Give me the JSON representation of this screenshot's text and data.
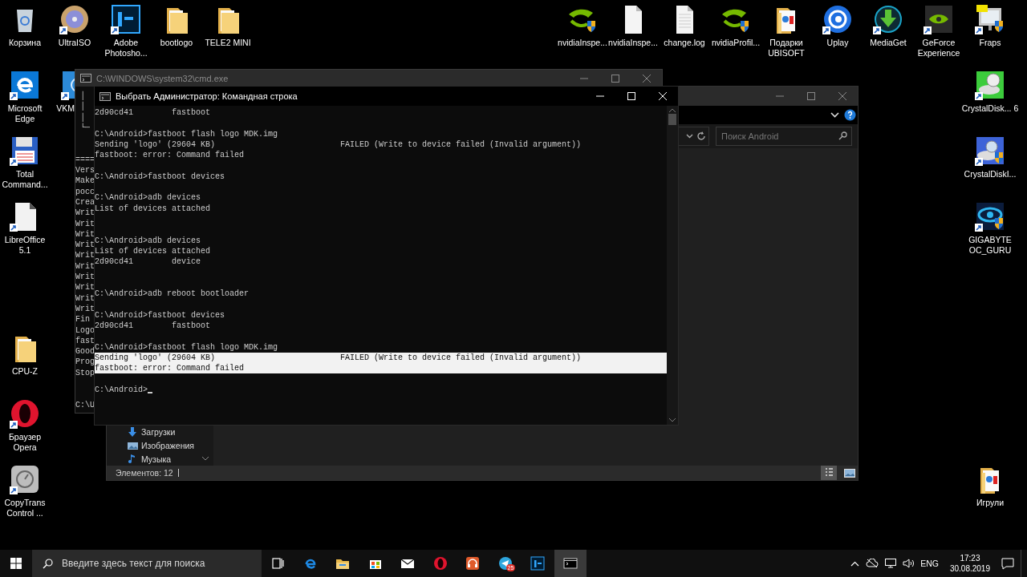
{
  "desktop_icons": [
    {
      "label": "Корзина",
      "kind": "bin",
      "shortcut": false
    },
    {
      "label": "UltraISO",
      "kind": "disc",
      "shortcut": true
    },
    {
      "label": "Adobe Photosho...",
      "kind": "ps",
      "shortcut": true
    },
    {
      "label": "bootlogo",
      "kind": "folder",
      "shortcut": false
    },
    {
      "label": "TELE2 MINI",
      "kind": "folder",
      "shortcut": false
    },
    {
      "label": "nvidiaInspe...",
      "kind": "nvidia",
      "shortcut": false
    },
    {
      "label": "nvidiaInspe...",
      "kind": "file",
      "shortcut": false
    },
    {
      "label": "change.log",
      "kind": "textfile",
      "shortcut": false
    },
    {
      "label": "nvidiaProfil...",
      "kind": "nvidia",
      "shortcut": false
    },
    {
      "label": "Подарки UBISOFT",
      "kind": "gift",
      "shortcut": false
    },
    {
      "label": "Uplay",
      "kind": "uplay",
      "shortcut": true
    },
    {
      "label": "MediaGet",
      "kind": "mediaget",
      "shortcut": true
    },
    {
      "label": "GeForce Experience",
      "kind": "geforce",
      "shortcut": true
    },
    {
      "label": "Fraps",
      "kind": "fraps",
      "shortcut": true
    },
    {
      "label": "Microsoft Edge",
      "kind": "edge",
      "shortcut": true
    },
    {
      "label": "VKM",
      "kind": "vkm",
      "shortcut": true
    },
    {
      "label": "CrystalDisk... 6",
      "kind": "crystal",
      "shortcut": true
    },
    {
      "label": "Total Command...",
      "kind": "floppy",
      "shortcut": true
    },
    {
      "label": "CrystalDiskI...",
      "kind": "crystal2",
      "shortcut": true
    },
    {
      "label": "LibreOffice 5.1",
      "kind": "document",
      "shortcut": true
    },
    {
      "label": "GIGABYTE OC_GURU",
      "kind": "gigabyte",
      "shortcut": true
    },
    {
      "label": "CPU-Z",
      "kind": "folder",
      "shortcut": false
    },
    {
      "label": "Браузер Opera",
      "kind": "opera",
      "shortcut": true
    },
    {
      "label": "CopyTrans Control ...",
      "kind": "gauge",
      "shortcut": true
    },
    {
      "label": "Игрули",
      "kind": "gift",
      "shortcut": false
    }
  ],
  "back_console": {
    "title": "C:\\WINDOWS\\system32\\cmd.exe",
    "lines": [
      {
        "kind": "text",
        "text": " │"
      },
      {
        "kind": "text",
        "text": " │"
      },
      {
        "kind": "text",
        "text": " │"
      },
      {
        "kind": "text",
        "text": " └─"
      },
      {
        "kind": "blank"
      },
      {
        "kind": "blank"
      },
      {
        "kind": "text",
        "text": "===="
      },
      {
        "kind": "text",
        "text": "Vers"
      },
      {
        "kind": "text",
        "text": "Make"
      },
      {
        "kind": "text",
        "text": "pocc"
      },
      {
        "kind": "text",
        "text": "Crea"
      },
      {
        "kind": "text",
        "text": "Writ"
      },
      {
        "kind": "text",
        "text": "Writ"
      },
      {
        "kind": "text",
        "text": "Writ"
      },
      {
        "kind": "text",
        "text": "Writ"
      },
      {
        "kind": "text",
        "text": "Writ"
      },
      {
        "kind": "text",
        "text": "Writ"
      },
      {
        "kind": "text",
        "text": "Writ"
      },
      {
        "kind": "text",
        "text": "Writ"
      },
      {
        "kind": "text",
        "text": "Writ"
      },
      {
        "kind": "text",
        "text": "Writ"
      },
      {
        "kind": "text",
        "text": "Fin"
      },
      {
        "kind": "text",
        "text": "Logo"
      },
      {
        "kind": "text",
        "text": "fast"
      },
      {
        "kind": "text",
        "text": "Good"
      },
      {
        "kind": "text",
        "text": "Prog"
      },
      {
        "kind": "text",
        "text": "Stop"
      },
      {
        "kind": "blank"
      },
      {
        "kind": "blank"
      },
      {
        "kind": "text",
        "text": "C:\\U"
      }
    ]
  },
  "explorer": {
    "search": {
      "placeholder": "Поиск Android"
    },
    "nav_items": [
      {
        "label": "Загрузки",
        "kind": "downloads"
      },
      {
        "label": "Изображения",
        "kind": "pictures"
      },
      {
        "label": "Музыка",
        "kind": "music"
      }
    ],
    "status": "Элементов: 12",
    "views": [
      {
        "kind": "details",
        "selected": true
      },
      {
        "kind": "thumbnails",
        "selected": false
      }
    ]
  },
  "console": {
    "title": "Выбрать Администратор: Командная строка",
    "lines": [
      {
        "kind": "text",
        "text": "2d90cd41        fastboot",
        "selected": false
      },
      {
        "kind": "blank"
      },
      {
        "kind": "text",
        "text": "C:\\Android>fastboot flash logo MDK.img",
        "selected": false
      },
      {
        "kind": "text",
        "text": "Sending 'logo' (29604 KB)                          FAILED (Write to device failed (Invalid argument))",
        "selected": false
      },
      {
        "kind": "text",
        "text": "fastboot: error: Command failed",
        "selected": false
      },
      {
        "kind": "blank"
      },
      {
        "kind": "text",
        "text": "C:\\Android>fastboot devices",
        "selected": false
      },
      {
        "kind": "blank"
      },
      {
        "kind": "text",
        "text": "C:\\Android>adb devices",
        "selected": false
      },
      {
        "kind": "text",
        "text": "List of devices attached",
        "selected": false
      },
      {
        "kind": "blank"
      },
      {
        "kind": "blank"
      },
      {
        "kind": "text",
        "text": "C:\\Android>adb devices",
        "selected": false
      },
      {
        "kind": "text",
        "text": "List of devices attached",
        "selected": false
      },
      {
        "kind": "text",
        "text": "2d90cd41        device",
        "selected": false
      },
      {
        "kind": "blank"
      },
      {
        "kind": "blank"
      },
      {
        "kind": "text",
        "text": "C:\\Android>adb reboot bootloader",
        "selected": false
      },
      {
        "kind": "blank"
      },
      {
        "kind": "text",
        "text": "C:\\Android>fastboot devices",
        "selected": false
      },
      {
        "kind": "text",
        "text": "2d90cd41        fastboot",
        "selected": false
      },
      {
        "kind": "blank"
      },
      {
        "kind": "text",
        "text": "C:\\Android>fastboot flash logo MDK.img",
        "selected": false
      },
      {
        "kind": "text",
        "text": "Sending 'logo' (29604 KB)                          FAILED (Write to device failed (Invalid argument))",
        "selected": true
      },
      {
        "kind": "text",
        "text": "fastboot: error: Command failed",
        "selected": true
      },
      {
        "kind": "blank"
      },
      {
        "kind": "prompt",
        "text": "C:\\Android>"
      }
    ]
  },
  "taskbar": {
    "search": {
      "placeholder": "Введите здесь текст для поиска"
    },
    "apps": [
      {
        "kind": "taskview",
        "selected": false
      },
      {
        "kind": "edge",
        "selected": false
      },
      {
        "kind": "explorer",
        "selected": false
      },
      {
        "kind": "store",
        "selected": false
      },
      {
        "kind": "mail",
        "selected": false
      },
      {
        "kind": "opera",
        "selected": false
      },
      {
        "kind": "headphones",
        "selected": false
      },
      {
        "kind": "telegram",
        "selected": false,
        "badge": "25"
      },
      {
        "kind": "ps",
        "selected": false
      },
      {
        "kind": "cmd",
        "selected": true
      }
    ],
    "language": "ENG",
    "time": "17:23",
    "date": "30.08.2019"
  }
}
